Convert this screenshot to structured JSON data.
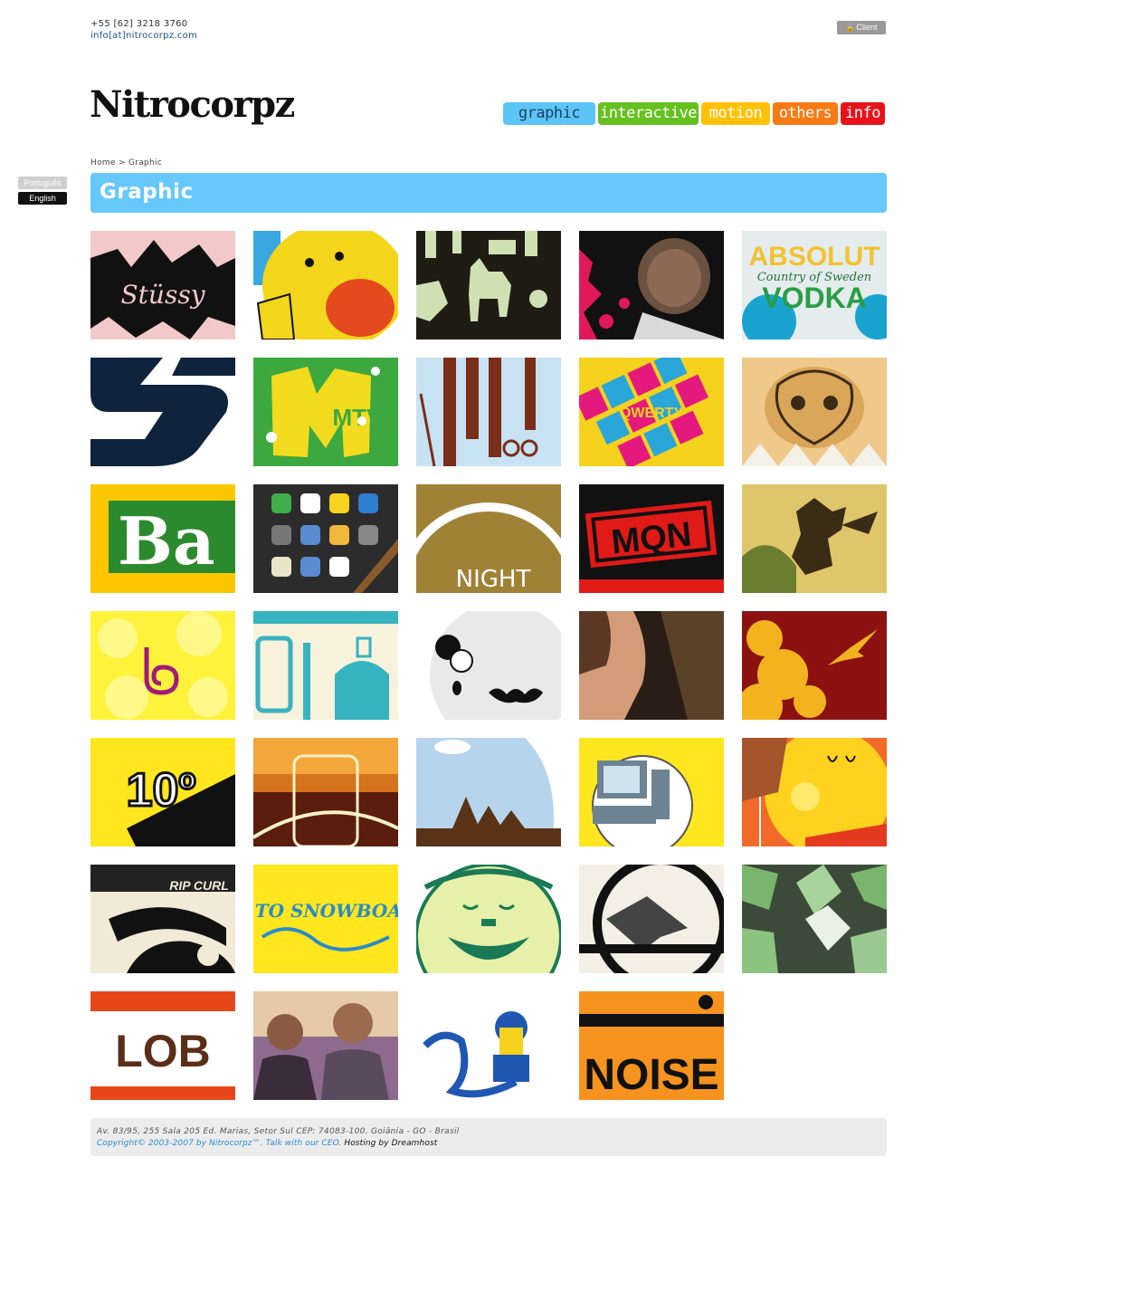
{
  "header": {
    "phone": "+55 [62] 3218 3760",
    "email": "info[at]nitrocorpz.com",
    "client_label": "Client",
    "logo": "Nitrocorpz"
  },
  "nav": {
    "graphic": "graphic",
    "interactive": "interactive",
    "motion": "motion",
    "others": "others",
    "info": "info"
  },
  "languages": {
    "portuguese": "Português",
    "english": "English"
  },
  "breadcrumb": "Home > Graphic",
  "page_title": "Graphic",
  "thumb_text": {
    "t1": "Stüssy",
    "t5a": "ABSOLUT",
    "t5b": "Country of Sweden",
    "t5c": "VODKA",
    "t7": "MTV",
    "t9": "QWERTY",
    "t11": "Ba",
    "t13": "NIGHT",
    "t14": "MQN",
    "t21": "10º",
    "t26": "RIP CURL",
    "t27": "UP TO SNOWBOARD",
    "t31": "LOB",
    "t34": "NOISE"
  },
  "colors": {
    "graphic": "#5dc5f5",
    "interactive": "#66c01f",
    "motion": "#ffc107",
    "others": "#f77a12",
    "info": "#e8131a",
    "title_bar": "#66c8fb"
  },
  "footer": {
    "address": "Av. 83/95, 255 Sala 205 Ed. Marias, Setor Sul CEP: 74083-100. Goiânia - GO - Brasil",
    "copyright": "Copyright© 2003-2007 by Nitrocorpz™. Talk with our CEO.",
    "hosting": "Hosting by Dreamhost"
  }
}
